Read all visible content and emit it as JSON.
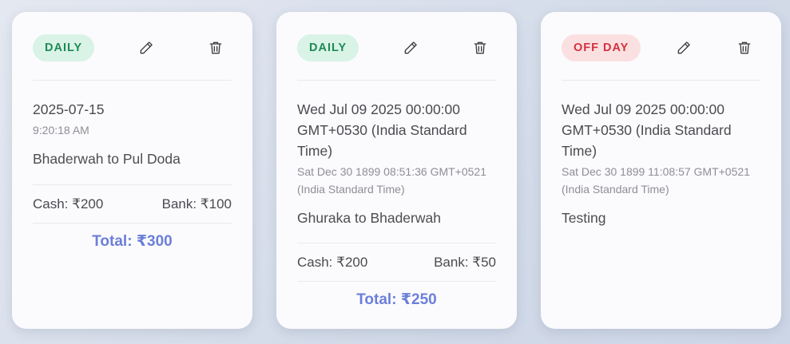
{
  "colors": {
    "daily_badge_bg": "#d9f3e6",
    "daily_badge_text": "#1f8a57",
    "off_badge_bg": "#fbe0e2",
    "off_badge_text": "#d3323d",
    "total_text": "#6c7fd9"
  },
  "cards": [
    {
      "badge": "DAILY",
      "edit_icon": "pencil-icon",
      "delete_icon": "trash-icon",
      "date": "2025-07-15",
      "time": "9:20:18 AM",
      "route": "Bhaderwah to Pul Doda",
      "cash": "Cash: ₹200",
      "bank": "Bank: ₹100",
      "total": "Total: ₹300"
    },
    {
      "badge": "DAILY",
      "edit_icon": "pencil-icon",
      "delete_icon": "trash-icon",
      "date": "Wed Jul 09 2025 00:00:00 GMT+0530 (India Standard Time)",
      "time": "Sat Dec 30 1899 08:51:36 GMT+0521 (India Standard Time)",
      "route": "Ghuraka to Bhaderwah",
      "cash": "Cash: ₹200",
      "bank": "Bank: ₹50",
      "total": "Total: ₹250"
    },
    {
      "badge": "OFF DAY",
      "edit_icon": "pencil-icon",
      "delete_icon": "trash-icon",
      "date": "Wed Jul 09 2025 00:00:00 GMT+0530 (India Standard Time)",
      "time": "Sat Dec 30 1899 11:08:57 GMT+0521 (India Standard Time)",
      "route": "Testing"
    }
  ]
}
